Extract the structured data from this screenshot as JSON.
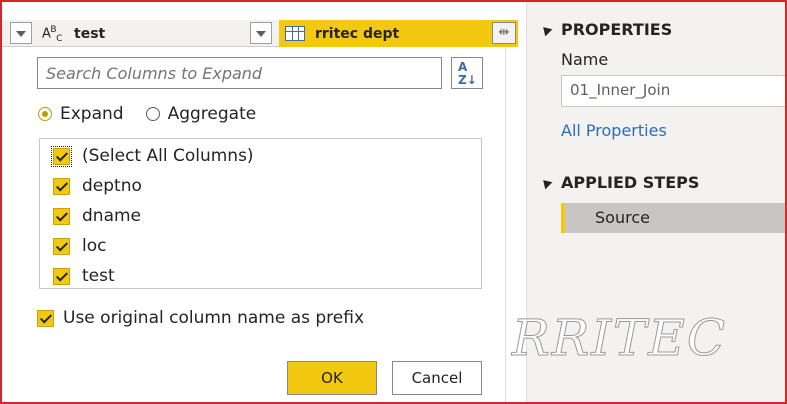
{
  "header": {
    "col1_type": "ABC",
    "col1_name": "test",
    "col2_name": "rritec dept"
  },
  "dialog": {
    "search_placeholder": "Search Columns to Expand",
    "sort_label": "A Z",
    "radio_expand": "Expand",
    "radio_aggregate": "Aggregate",
    "items": [
      {
        "label": "(Select All Columns)",
        "checked": true
      },
      {
        "label": "deptno",
        "checked": true
      },
      {
        "label": "dname",
        "checked": true
      },
      {
        "label": "loc",
        "checked": true
      },
      {
        "label": "test",
        "checked": true
      }
    ],
    "prefix_label": "Use original column name as prefix",
    "ok_label": "OK",
    "cancel_label": "Cancel"
  },
  "properties": {
    "title": "PROPERTIES",
    "name_label": "Name",
    "name_value": "01_Inner_Join",
    "all_properties": "All Properties",
    "applied_steps_title": "APPLIED STEPS",
    "steps": [
      "Source"
    ]
  },
  "watermark": "RRITEC"
}
